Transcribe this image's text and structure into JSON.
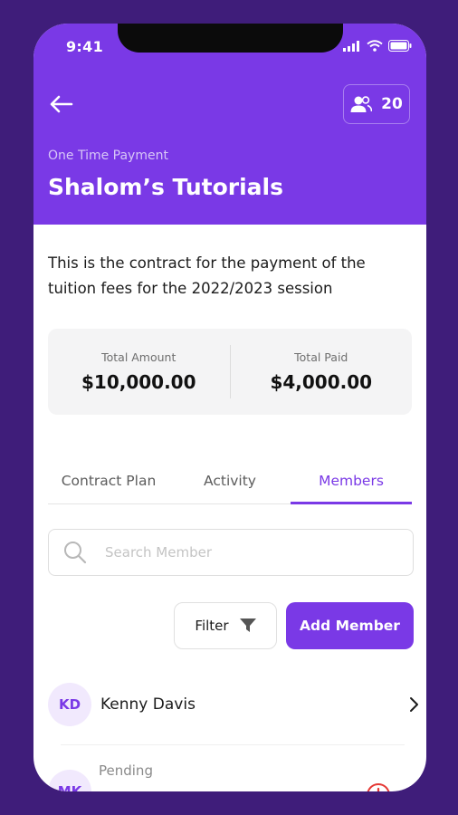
{
  "status_bar": {
    "time": "9:41"
  },
  "header": {
    "members_count": "20",
    "subtitle": "One Time Payment",
    "title": "Shalom’s Tutorials"
  },
  "description": "This is the contract for the payment of the tuition fees for the 2022/2023 session",
  "summary": {
    "total_amount_label": "Total Amount",
    "total_amount_value": "$10,000.00",
    "total_paid_label": "Total Paid",
    "total_paid_value": "$4,000.00"
  },
  "tabs": [
    {
      "label": "Contract Plan",
      "active": false
    },
    {
      "label": "Activity",
      "active": false
    },
    {
      "label": "Members",
      "active": true
    }
  ],
  "search": {
    "placeholder": "Search Member"
  },
  "actions": {
    "filter_label": "Filter",
    "add_member_label": "Add Member"
  },
  "members": [
    {
      "initials": "KD",
      "name": "Kenny Davis"
    },
    {
      "initials": "MK",
      "status": "Pending"
    }
  ],
  "colors": {
    "brand": "#7a39e6",
    "background": "#3f1d7a",
    "avatar_bg": "#f1e9fd",
    "alert": "#e53935"
  }
}
